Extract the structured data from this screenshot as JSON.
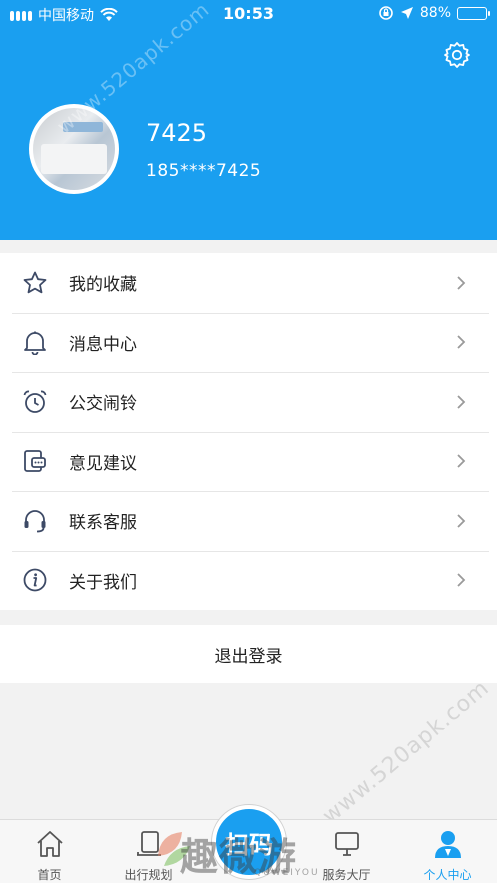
{
  "status_bar": {
    "carrier": "中国移动",
    "time": "10:53",
    "battery_percent": "88%"
  },
  "profile": {
    "username": "7425",
    "phone": "185****7425"
  },
  "menu": [
    {
      "label": "我的收藏",
      "icon": "star-icon"
    },
    {
      "label": "消息中心",
      "icon": "bell-icon"
    },
    {
      "label": "公交闹铃",
      "icon": "alarm-clock-icon"
    },
    {
      "label": "意见建议",
      "icon": "feedback-icon"
    },
    {
      "label": "联系客服",
      "icon": "headset-icon"
    },
    {
      "label": "关于我们",
      "icon": "info-icon"
    }
  ],
  "logout_label": "退出登录",
  "tabbar": {
    "tabs": [
      {
        "label": "首页",
        "icon": "home-icon"
      },
      {
        "label": "出行规划",
        "icon": "route-plan-icon"
      },
      {
        "label": "服务大厅",
        "icon": "service-hall-icon"
      },
      {
        "label": "个人中心",
        "icon": "person-icon"
      }
    ],
    "active_tab": "个人中心",
    "scan_label": "扫码"
  },
  "watermark": {
    "site": "www.520apk.com",
    "logo": "趣微游",
    "sub": "QUWEIYOU"
  },
  "colors": {
    "brand": "#1a9ff0",
    "background": "#f2f2f2",
    "text": "#222222"
  }
}
